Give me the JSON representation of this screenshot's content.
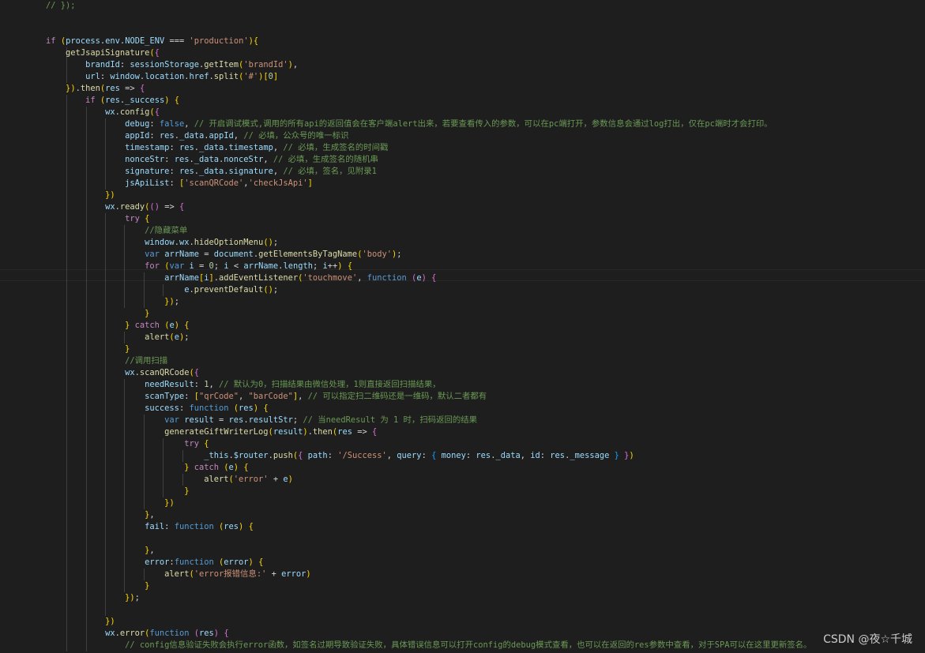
{
  "editor": {
    "language": "javascript",
    "theme_background": "#1e1e1e",
    "active_line": 23,
    "lines": [
      "    // });",
      "",
      "",
      "    if (process.env.NODE_ENV === 'production'){",
      "        getJsapiSignature({",
      "            brandId: sessionStorage.getItem('brandId'),",
      "            url: window.location.href.split('#')[0]",
      "        }).then(res => {",
      "            if (res._success) {",
      "                wx.config({",
      "                    debug: false, // 开启调试模式,调用的所有api的返回值会在客户端alert出来，若要查看传入的参数，可以在pc端打开，参数信息会通过log打出，仅在pc端时才会打印。",
      "                    appId: res._data.appId, // 必填，公众号的唯一标识",
      "                    timestamp: res._data.timestamp, // 必填，生成签名的时间戳",
      "                    nonceStr: res._data.nonceStr, // 必填，生成签名的随机串",
      "                    signature: res._data.signature, // 必填，签名，见附录1",
      "                    jsApiList: ['scanQRCode','checkJsApi']",
      "                })",
      "                wx.ready(() => {",
      "                    try {",
      "                        //隐藏菜单",
      "                        window.wx.hideOptionMenu();",
      "                        var arrName = document.getElementsByTagName('body');",
      "                        for (var i = 0; i < arrName.length; i++) {",
      "                            arrName[i].addEventListener('touchmove', function (e) {",
      "                                e.preventDefault();",
      "                            });",
      "                        }",
      "                    } catch (e) {",
      "                        alert(e);",
      "                    }",
      "                    //调用扫描",
      "                    wx.scanQRCode({",
      "                        needResult: 1, // 默认为0，扫描结果由微信处理，1则直接返回扫描结果，",
      "                        scanType: [\"qrCode\", \"barCode\"], // 可以指定扫二维码还是一维码，默认二者都有",
      "                        success: function (res) {",
      "                            var result = res.resultStr; // 当needResult 为 1 时，扫码返回的结果",
      "                            generateGiftWriterLog(result).then(res => {",
      "                                try {",
      "                                    _this.$router.push({ path: '/Success', query: { money: res._data, id: res._message } })",
      "                                } catch (e) {",
      "                                    alert('error' + e)",
      "                                }",
      "                            })",
      "                        },",
      "                        fail: function (res) {",
      "",
      "                        },",
      "                        error:function (error) {",
      "                            alert('error报错信息:' + error)",
      "                        }",
      "                    });",
      "",
      "                })",
      "                wx.error(function (res) {",
      "                    // config信息验证失败会执行error函数，如签名过期导致验证失败，具体错误信息可以打开config的debug模式查看，也可以在返回的res参数中查看，对于SPA可以在这里更新签名。"
    ]
  },
  "watermark": {
    "text": "CSDN @夜☆千城"
  }
}
